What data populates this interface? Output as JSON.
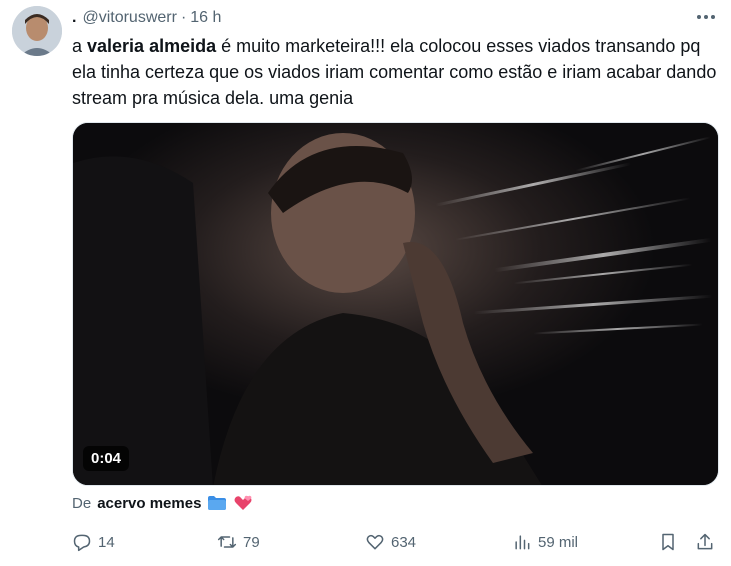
{
  "tweet": {
    "display_name": ".",
    "handle": "@vitoruswerr",
    "separator": "·",
    "time": "16 h",
    "text_prefix": "a ",
    "text_bold": "valeria almeida",
    "text_rest": " é muito marketeira!!! ela colocou esses viados transando pq ela tinha certeza que os viados iriam comentar como estão e iriam acabar dando stream pra música dela. uma genia"
  },
  "media": {
    "duration": "0:04"
  },
  "source": {
    "prefix": "De",
    "handle": "acervo memes"
  },
  "actions": {
    "replies": "14",
    "reposts": "79",
    "likes": "634",
    "views": "59 mil"
  },
  "icons": {
    "more": "more-icon",
    "reply": "reply-icon",
    "repost": "repost-icon",
    "like": "heart-icon",
    "views": "views-icon",
    "bookmark": "bookmark-icon",
    "share": "share-icon",
    "folder": "folder-icon",
    "hearts": "hearts-icon"
  },
  "colors": {
    "text": "#0f1419",
    "secondary": "#536471",
    "folder": "#3a8ee6",
    "heart": "#e8436b"
  }
}
